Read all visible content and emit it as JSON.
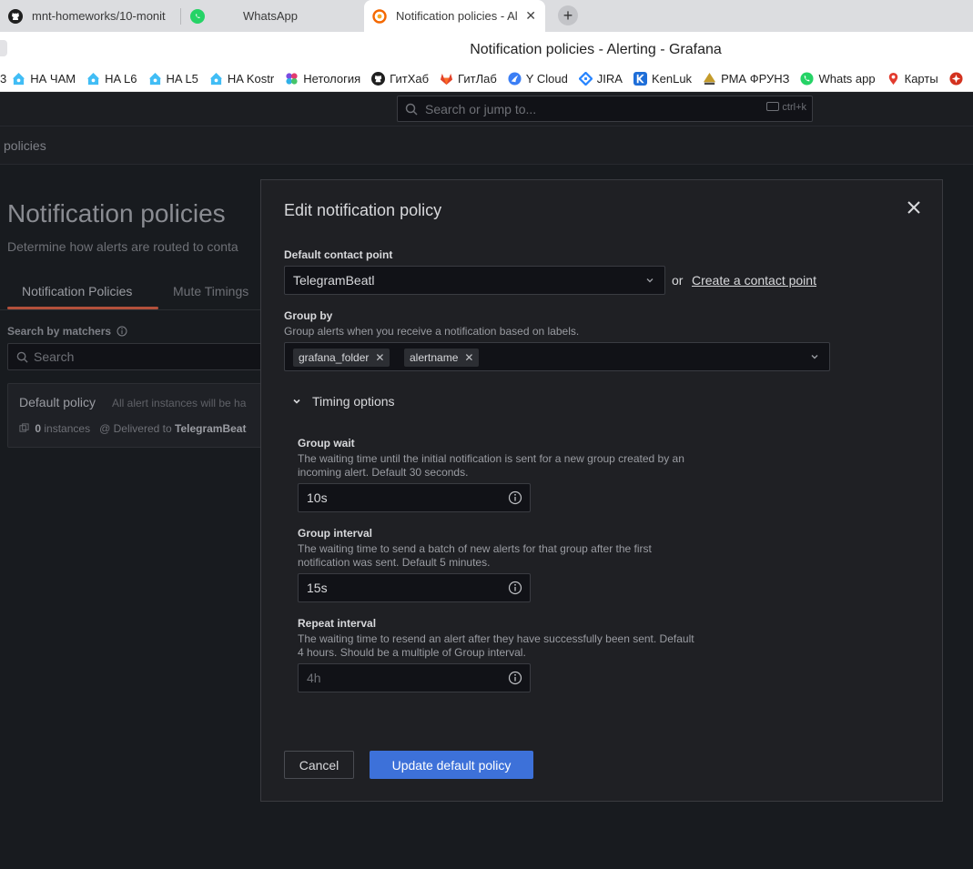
{
  "browser": {
    "tabs": [
      {
        "title": "mnt-homeworks/10-monit",
        "icon": "github-icon"
      },
      {
        "title": "WhatsApp",
        "icon": "whatsapp-icon"
      },
      {
        "title": "Notification policies - Al",
        "icon": "grafana-icon",
        "active": true
      }
    ],
    "new_tab_glyph": "+",
    "close_glyph": "✕",
    "window_title": "Notification policies - Alerting - Grafana",
    "bookmarks": [
      {
        "label": "НА ЧАМ",
        "icon": "home-assistant-icon",
        "color": "#41bdf5"
      },
      {
        "label": "HA L6",
        "icon": "home-assistant-icon",
        "color": "#41bdf5"
      },
      {
        "label": "HA L5",
        "icon": "home-assistant-icon",
        "color": "#41bdf5"
      },
      {
        "label": "HA Kostr",
        "icon": "home-assistant-icon",
        "color": "#41bdf5"
      },
      {
        "label": "Нетология",
        "icon": "netology-icon",
        "color": "#7b4ce0"
      },
      {
        "label": "ГитХаб",
        "icon": "github-icon",
        "color": "#1f1f1f"
      },
      {
        "label": "ГитЛаб",
        "icon": "gitlab-icon",
        "color": "#e24329"
      },
      {
        "label": "Y Cloud",
        "icon": "yandex-cloud-icon",
        "color": "#3a7ef5"
      },
      {
        "label": "JIRA",
        "icon": "jira-icon",
        "color": "#2684ff"
      },
      {
        "label": "KenLuk",
        "icon": "kenluk-icon",
        "color": "#1e6ed8"
      },
      {
        "label": "РМА ФРУНЗ",
        "icon": "pma-icon",
        "color": "#c49b2b"
      },
      {
        "label": "Whats app",
        "icon": "whatsapp-icon",
        "color": "#25d366"
      },
      {
        "label": "Карты",
        "icon": "map-pin-icon",
        "color": "#e23b2e"
      }
    ]
  },
  "grafana": {
    "search_placeholder": "Search or jump to...",
    "search_shortcut": "ctrl+k",
    "breadcrumb": "policies",
    "page_title": "Notification policies",
    "page_subtitle": "Determine how alerts are routed to conta",
    "tabs": [
      "Notification Policies",
      "Mute Timings"
    ],
    "search_label": "Search by matchers",
    "search_placeholder_matchers": "Search",
    "default_policy": {
      "title": "Default policy",
      "note": "All alert instances will be ha",
      "instances": "0",
      "instances_label": "instances",
      "delivered_prefix": "Delivered to",
      "delivered_to": "TelegramBeat"
    }
  },
  "modal": {
    "title": "Edit notification policy",
    "contact_point": {
      "label": "Default contact point",
      "value": "TelegramBeatl",
      "or": "or",
      "create_link": "Create a contact point"
    },
    "group_by": {
      "label": "Group by",
      "description": "Group alerts when you receive a notification based on labels.",
      "chips": [
        "grafana_folder",
        "alertname"
      ]
    },
    "timing": {
      "toggle_label": "Timing options",
      "group_wait": {
        "label": "Group wait",
        "description_1": "The waiting time until the initial notification is sent for a new group created by an",
        "description_2": "incoming alert. Default 30 seconds.",
        "value": "10s",
        "placeholder": ""
      },
      "group_interval": {
        "label": "Group interval",
        "description_1": "The waiting time to send a batch of new alerts for that group after the first",
        "description_2": "notification was sent. Default 5 minutes.",
        "value": "15s",
        "placeholder": ""
      },
      "repeat_interval": {
        "label": "Repeat interval",
        "description_1": "The waiting time to resend an alert after they have successfully been sent. Default",
        "description_2": "4 hours. Should be a multiple of Group interval.",
        "value": "",
        "placeholder": "4h"
      }
    },
    "buttons": {
      "cancel": "Cancel",
      "submit": "Update default policy"
    }
  }
}
